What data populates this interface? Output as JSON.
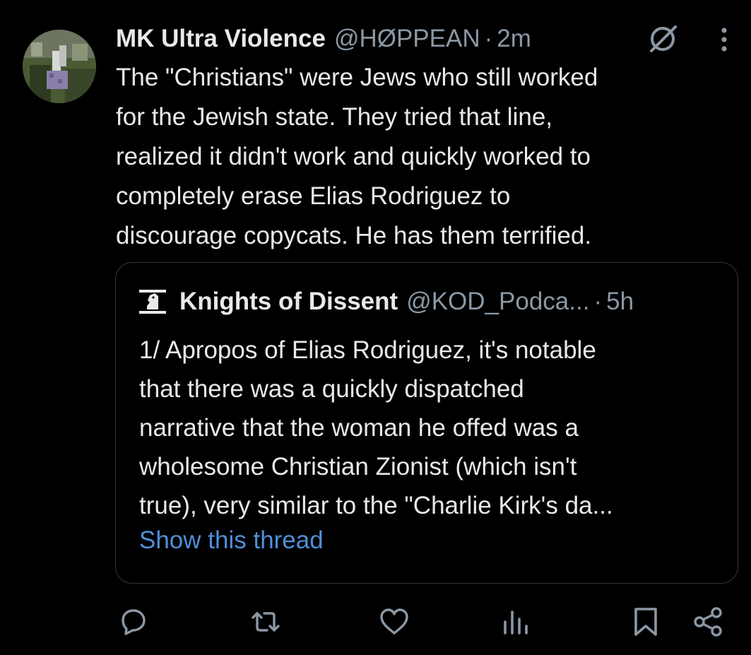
{
  "tweet": {
    "display_name": "MK Ultra Violence",
    "handle": "@HØPPEAN",
    "separator": "·",
    "time": "2m",
    "text": "The \"Christians\" were Jews who still worked\nfor the Jewish state. They tried that line,\nrealized it didn't work and quickly worked to\ncompletely erase Elias Rodriguez to\ndiscourage copycats. He has them terrified."
  },
  "quoted": {
    "display_name": "Knights of Dissent",
    "handle": "@KOD_Podca...",
    "separator": "·",
    "time": "5h",
    "text": "1/ Apropos of Elias Rodriguez, it's notable\nthat there was a quickly dispatched\nnarrative that the woman he offed was a\nwholesome Christian Zionist (which isn't\ntrue), very similar to the \"Charlie Kirk's da...",
    "show_thread_label": "Show this thread"
  },
  "icons": {
    "header": [
      "grok-icon",
      "more-vertical-icon"
    ],
    "actions": [
      "reply-icon",
      "repost-icon",
      "like-icon",
      "views-icon",
      "bookmark-icon",
      "share-icon"
    ]
  },
  "colors": {
    "background": "#000000",
    "text": "#e7e9ea",
    "muted": "#8b98a5",
    "link": "#4f8fd9",
    "border": "#333639"
  }
}
